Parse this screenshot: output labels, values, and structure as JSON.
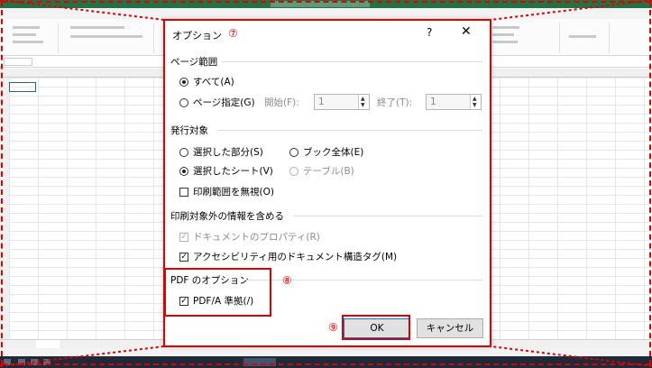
{
  "dialog": {
    "title": "オプション",
    "title_marker": "⑦",
    "help_label": "?",
    "close_label": "✕",
    "page_range": {
      "heading": "ページ範囲",
      "all_label": "すべて(A)",
      "pages_label": "ページ指定(G)",
      "from_label": "開始(F):",
      "from_value": "1",
      "to_label": "終了(T):",
      "to_value": "1"
    },
    "publish_target": {
      "heading": "発行対象",
      "selection_label": "選択した部分(S)",
      "workbook_label": "ブック全体(E)",
      "selected_sheets_label": "選択したシート(V)",
      "table_label": "テーブル(B)",
      "ignore_print_area_label": "印刷範囲を無視(O)"
    },
    "non_print_info": {
      "heading": "印刷対象外の情報を含める",
      "doc_properties_label": "ドキュメントのプロパティ(R)",
      "accessibility_tags_label": "アクセシビリティ用のドキュメント構造タグ(M)"
    },
    "pdf_options": {
      "heading": "PDF のオプション",
      "marker": "⑧",
      "pdfa_label": "PDF/A 準拠(/)"
    },
    "ok_marker": "⑨",
    "ok_label": "OK",
    "cancel_label": "キャンセル"
  },
  "icons": {
    "check": "✓"
  },
  "colors": {
    "excel_green": "#217346",
    "annotation_red": "#e00000",
    "ok_border": "#0078d7"
  }
}
